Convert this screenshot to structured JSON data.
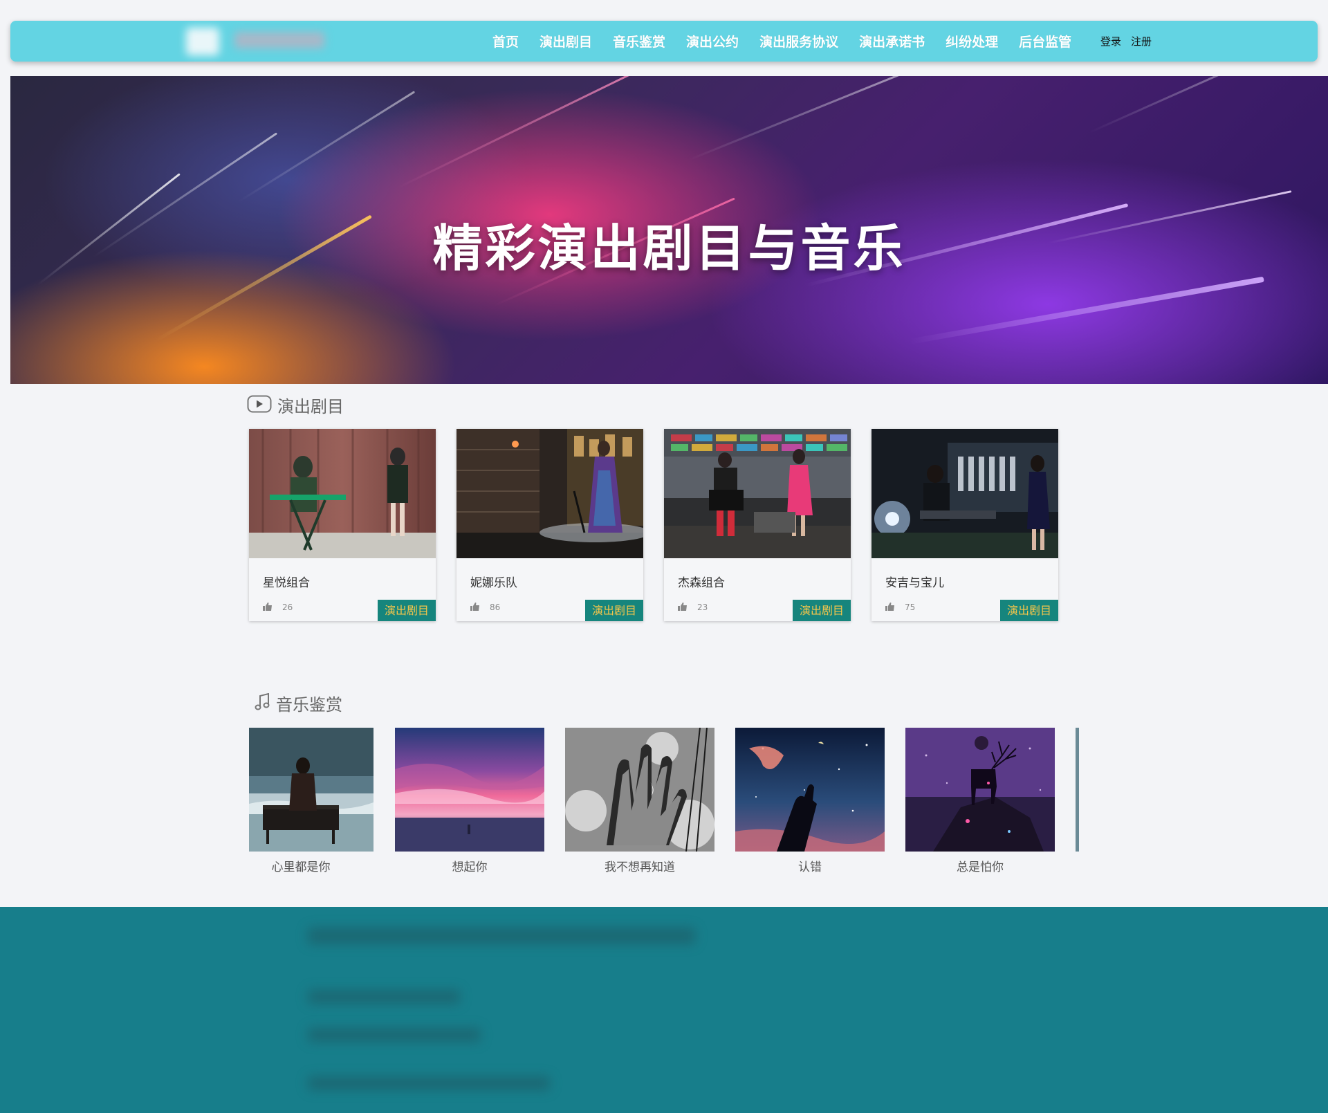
{
  "header": {
    "nav": [
      "首页",
      "演出剧目",
      "音乐鉴赏",
      "演出公约",
      "演出服务协议",
      "演出承诺书",
      "纠纷处理",
      "后台监管"
    ],
    "login": "登录",
    "register": "注册",
    "bar_color": "#63d4e3"
  },
  "banner": {
    "title": "精彩演出剧目与音乐"
  },
  "shows_section": {
    "title": "演出剧目",
    "icon": "play-icon",
    "items": [
      {
        "name": "星悦组合",
        "likes": "26",
        "tag": "演出剧目"
      },
      {
        "name": "妮娜乐队",
        "likes": "86",
        "tag": "演出剧目"
      },
      {
        "name": "杰森组合",
        "likes": "23",
        "tag": "演出剧目"
      },
      {
        "name": "安吉与宝儿",
        "likes": "75",
        "tag": "演出剧目"
      }
    ]
  },
  "music_section": {
    "title": "音乐鉴赏",
    "icon": "music-note-icon",
    "items": [
      {
        "title": "心里都是你"
      },
      {
        "title": "想起你"
      },
      {
        "title": "我不想再知道"
      },
      {
        "title": "认错"
      },
      {
        "title": "总是怕你"
      }
    ]
  },
  "colors": {
    "tag_bg": "#16857d",
    "tag_text": "#f7c64a",
    "footer_bg": "#177e8b"
  }
}
